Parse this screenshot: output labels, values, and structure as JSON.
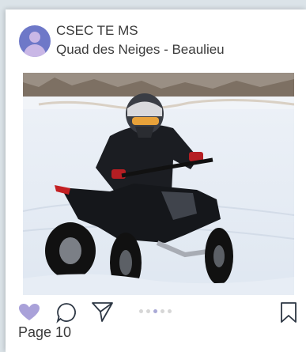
{
  "post": {
    "username": "CSEC TE MS",
    "location": "Quad des Neiges - Beaulieu",
    "image_alt": "Rider on a black quad bike in the snow",
    "liked": true,
    "carousel": {
      "count": 5,
      "active_index": 2
    }
  },
  "footer": {
    "page_label": "Page 10"
  },
  "colors": {
    "accent": "#a9a1d9",
    "avatar": "#6e78c8"
  }
}
